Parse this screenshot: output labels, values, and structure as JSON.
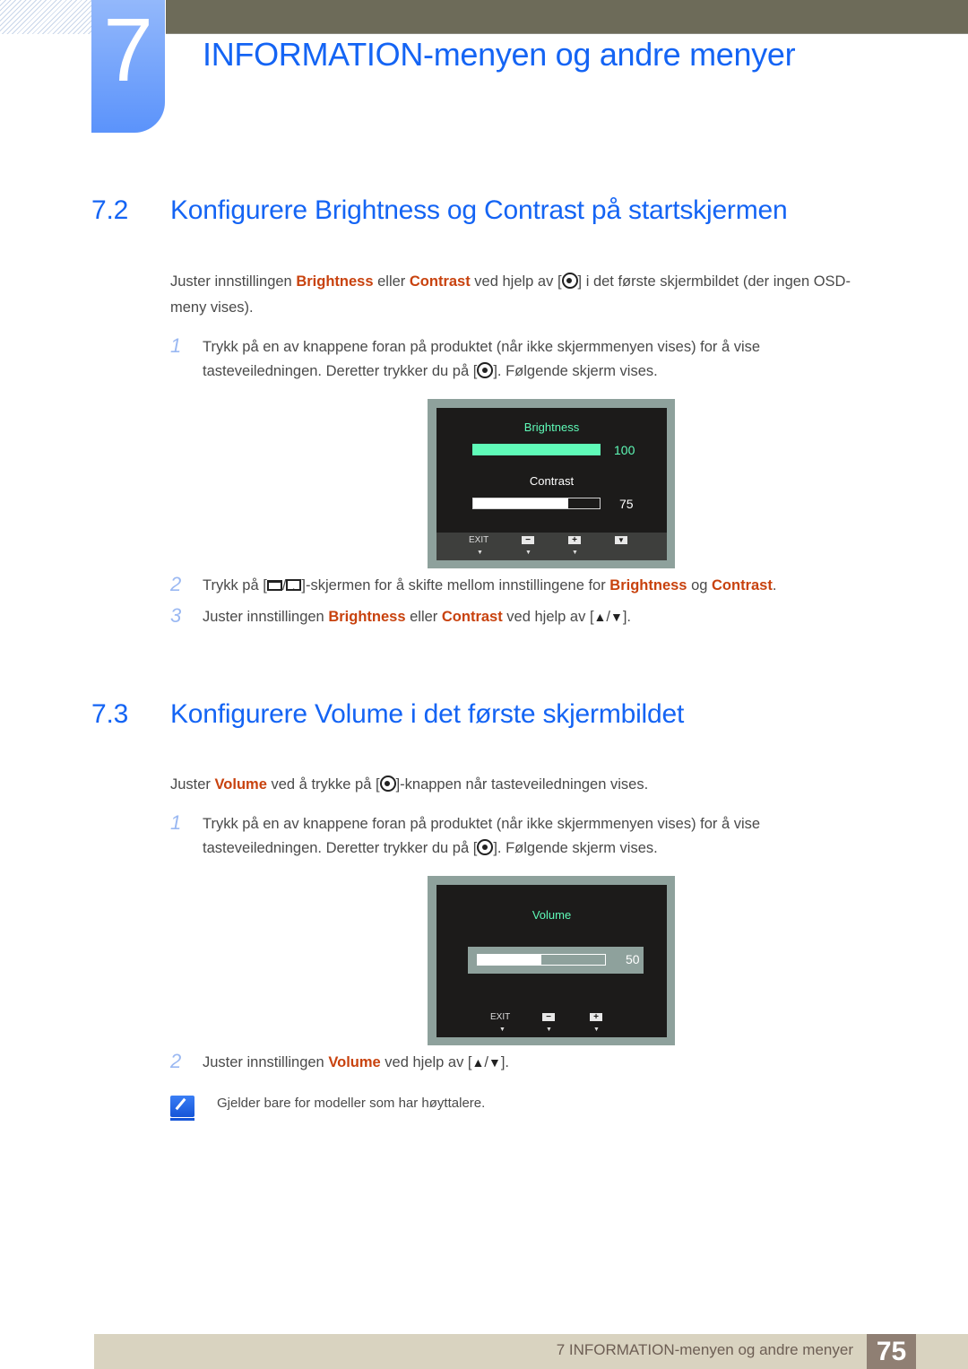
{
  "chapter": {
    "number": "7",
    "title": "INFORMATION-menyen og andre menyer"
  },
  "section_72": {
    "number": "7.2",
    "title": "Konfigurere Brightness og Contrast på startskjermen",
    "intro": {
      "p1": "Juster innstillingen ",
      "hl1": "Brightness",
      "p2": " eller ",
      "hl2": "Contrast",
      "p3": " ved hjelp av [",
      "p4": "] i det første skjermbildet (der ingen OSD-",
      "p5": "meny vises)."
    },
    "steps": [
      {
        "num": "1",
        "line1": "Trykk på en av knappene foran på produktet (når ikke skjermmenyen vises) for å vise",
        "line2a": "tasteveiledningen. Deretter trykker du på [",
        "line2b": "]. Følgende skjerm vises."
      },
      {
        "num": "2",
        "a": "Trykk på [",
        "sep": "/",
        "b": "]-skjermen for å skifte mellom innstillingene for ",
        "hl1": "Brightness",
        "c": " og ",
        "hl2": "Contrast",
        "d": "."
      },
      {
        "num": "3",
        "a": "Juster innstillingen ",
        "hl1": "Brightness",
        "b": " eller ",
        "hl2": "Contrast",
        "c": " ved hjelp av [",
        "up": "▲",
        "sep": "/",
        "down": "▼",
        "d": "]."
      }
    ],
    "osd": {
      "brightness_label": "Brightness",
      "brightness_value": "100",
      "brightness_level": 1.0,
      "contrast_label": "Contrast",
      "contrast_value": "75",
      "contrast_level": 0.75,
      "buttons": {
        "exit": "EXIT",
        "minus": "−",
        "plus": "+",
        "down": "▼"
      },
      "arrow": "▼",
      "colors": {
        "active": "#5ffbb8",
        "text": "#ffffff"
      }
    }
  },
  "section_73": {
    "number": "7.3",
    "title": "Konfigurere Volume i det første skjermbildet",
    "intro": {
      "p1": "Juster ",
      "hl": "Volume",
      "p2": " ved å trykke på [",
      "p3": "]-knappen når tasteveiledningen vises."
    },
    "steps": [
      {
        "num": "1",
        "line1": "Trykk på en av knappene foran på produktet (når ikke skjermmenyen vises) for å vise",
        "line2a": "tasteveiledningen. Deretter trykker du på [",
        "line2b": "]. Følgende skjerm vises."
      },
      {
        "num": "2",
        "a": "Juster innstillingen ",
        "hl": "Volume",
        "b": " ved hjelp av [",
        "up": "▲",
        "sep": "/",
        "down": "▼",
        "c": "]."
      }
    ],
    "osd": {
      "volume_label": "Volume",
      "volume_value": "50",
      "volume_level": 0.5,
      "buttons": {
        "exit": "EXIT",
        "minus": "−",
        "plus": "+"
      },
      "arrow": "▼"
    },
    "note": "Gjelder bare for modeller som har høyttalere."
  },
  "footer": {
    "text": "7 INFORMATION-menyen og andre menyer",
    "page": "75"
  },
  "colors": {
    "heading_blue": "#1464f4",
    "highlight_orange": "#c8420e",
    "step_number": "#9ab8f2",
    "footer_bg": "#d9d3c0",
    "page_box": "#8f7f73"
  }
}
